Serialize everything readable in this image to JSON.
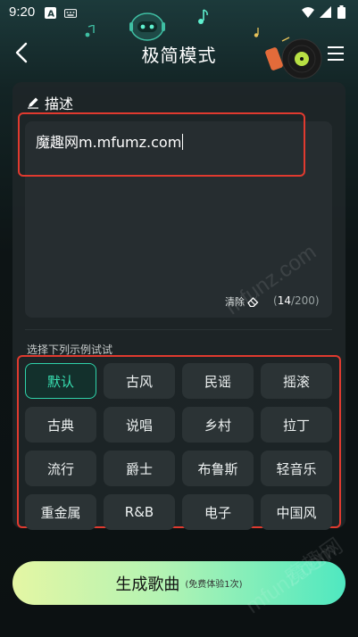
{
  "status_bar": {
    "time": "9:20"
  },
  "header": {
    "title": "极简模式"
  },
  "description": {
    "label": "描述",
    "value": "魔趣网m.mfumz.com",
    "clear_label": "清除",
    "count_current": "14",
    "count_sep": "/200"
  },
  "examples": {
    "hint": "选择下列示例试试",
    "tags": [
      "默认",
      "古风",
      "民谣",
      "摇滚",
      "古典",
      "说唱",
      "乡村",
      "拉丁",
      "流行",
      "爵士",
      "布鲁斯",
      "轻音乐",
      "重金属",
      "R&B",
      "电子",
      "中国风"
    ],
    "selected": "默认"
  },
  "generate": {
    "label": "生成歌曲",
    "sub": "(免费体验1次)"
  },
  "watermarks": [
    "mfunz.com",
    "mfunz.com",
    "魔趣网"
  ],
  "colors": {
    "accent": "#2fd3aa",
    "highlight": "#e03a2f",
    "button_from": "#e4f6a4",
    "button_to": "#4fe8c0"
  }
}
